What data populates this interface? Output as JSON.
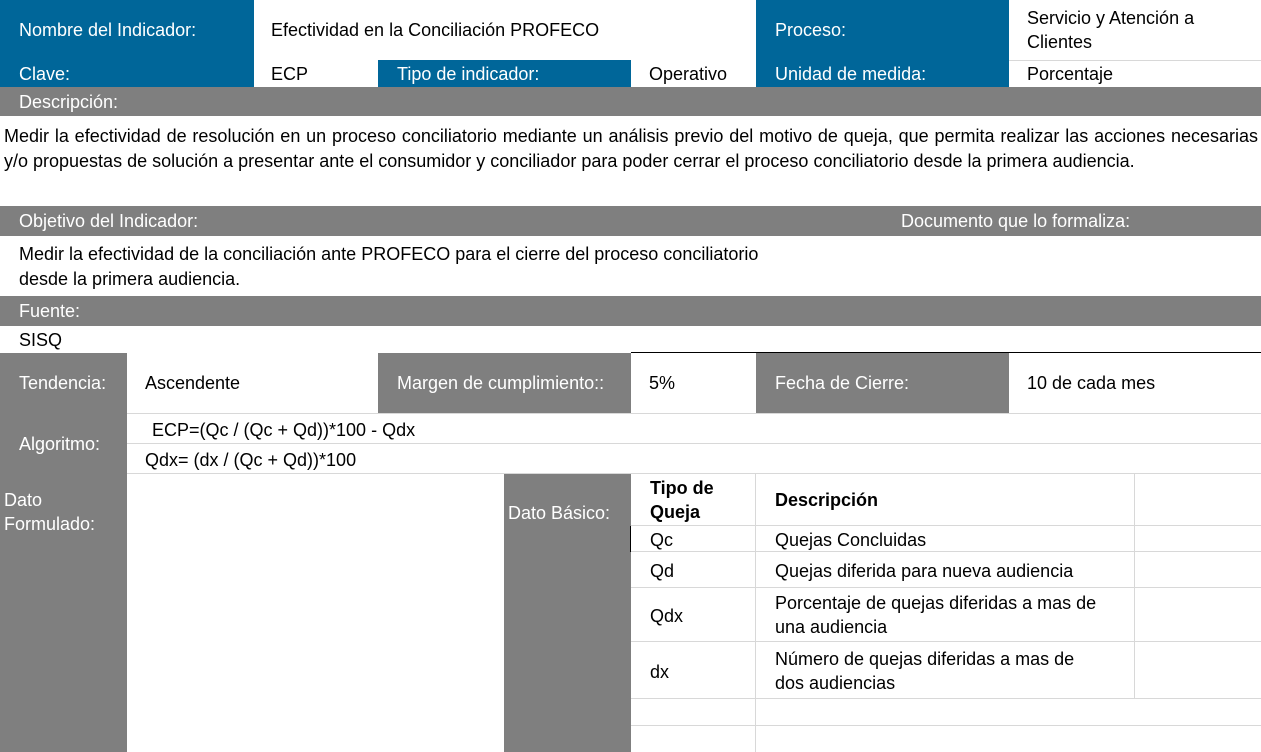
{
  "header": {
    "nombre_label": "Nombre del Indicador:",
    "nombre_value": "Efectividad en la Conciliación PROFECO",
    "proceso_label": "Proceso:",
    "proceso_value": "Servicio y Atención a Clientes",
    "clave_label": "Clave:",
    "clave_value": "ECP",
    "tipo_label": "Tipo de indicador:",
    "tipo_value": "Operativo",
    "unidad_label": "Unidad de medida:",
    "unidad_value": "Porcentaje"
  },
  "descripcion": {
    "label": "Descripción:",
    "text": "Medir la efectividad de resolución en un proceso conciliatorio mediante un análisis previo del motivo de queja, que permita realizar las acciones necesarias y/o propuestas de solución a presentar ante el consumidor y conciliador para poder cerrar el proceso conciliatorio desde la primera audiencia."
  },
  "objetivo": {
    "label": "Objetivo del Indicador:",
    "documento_label": "Documento que lo formaliza:",
    "line1": "Medir la efectividad de la conciliación ante PROFECO para el cierre del proceso conciliatorio",
    "line2": "desde la primera audiencia."
  },
  "fuente": {
    "label": "Fuente:",
    "value": "SISQ"
  },
  "metrics": {
    "tendencia_label": "Tendencia:",
    "tendencia_value": "Ascendente",
    "margen_label": "Margen de cumplimiento::",
    "margen_value": "5%",
    "fecha_label": "Fecha de Cierre:",
    "fecha_value": "10 de cada mes"
  },
  "algoritmo": {
    "label": "Algoritmo:",
    "formula1": "ECP=(Qc / (Qc + Qd))*100 - Qdx",
    "formula2": "Qdx= (dx / (Qc + Qd))*100"
  },
  "dato_formulado": {
    "line1": "Dato",
    "line2": "Formulado:"
  },
  "dato_basico": {
    "label": "Dato Básico:",
    "col_tipo_line1": "Tipo de",
    "col_tipo_line2": "Queja",
    "col_desc": "Descripción",
    "rows": [
      {
        "tipo": "Qc",
        "desc1": "Quejas Concluidas",
        "desc2": ""
      },
      {
        "tipo": "Qd",
        "desc1": "Quejas diferida para nueva audiencia",
        "desc2": ""
      },
      {
        "tipo": "Qdx",
        "desc1": "Porcentaje de quejas diferidas a mas de",
        "desc2": "una audiencia"
      },
      {
        "tipo": "dx",
        "desc1": "Número de quejas diferidas a mas de",
        "desc2": "dos audiencias"
      }
    ]
  },
  "colors": {
    "blue": "#006699",
    "gray": "#7f7f7f"
  }
}
